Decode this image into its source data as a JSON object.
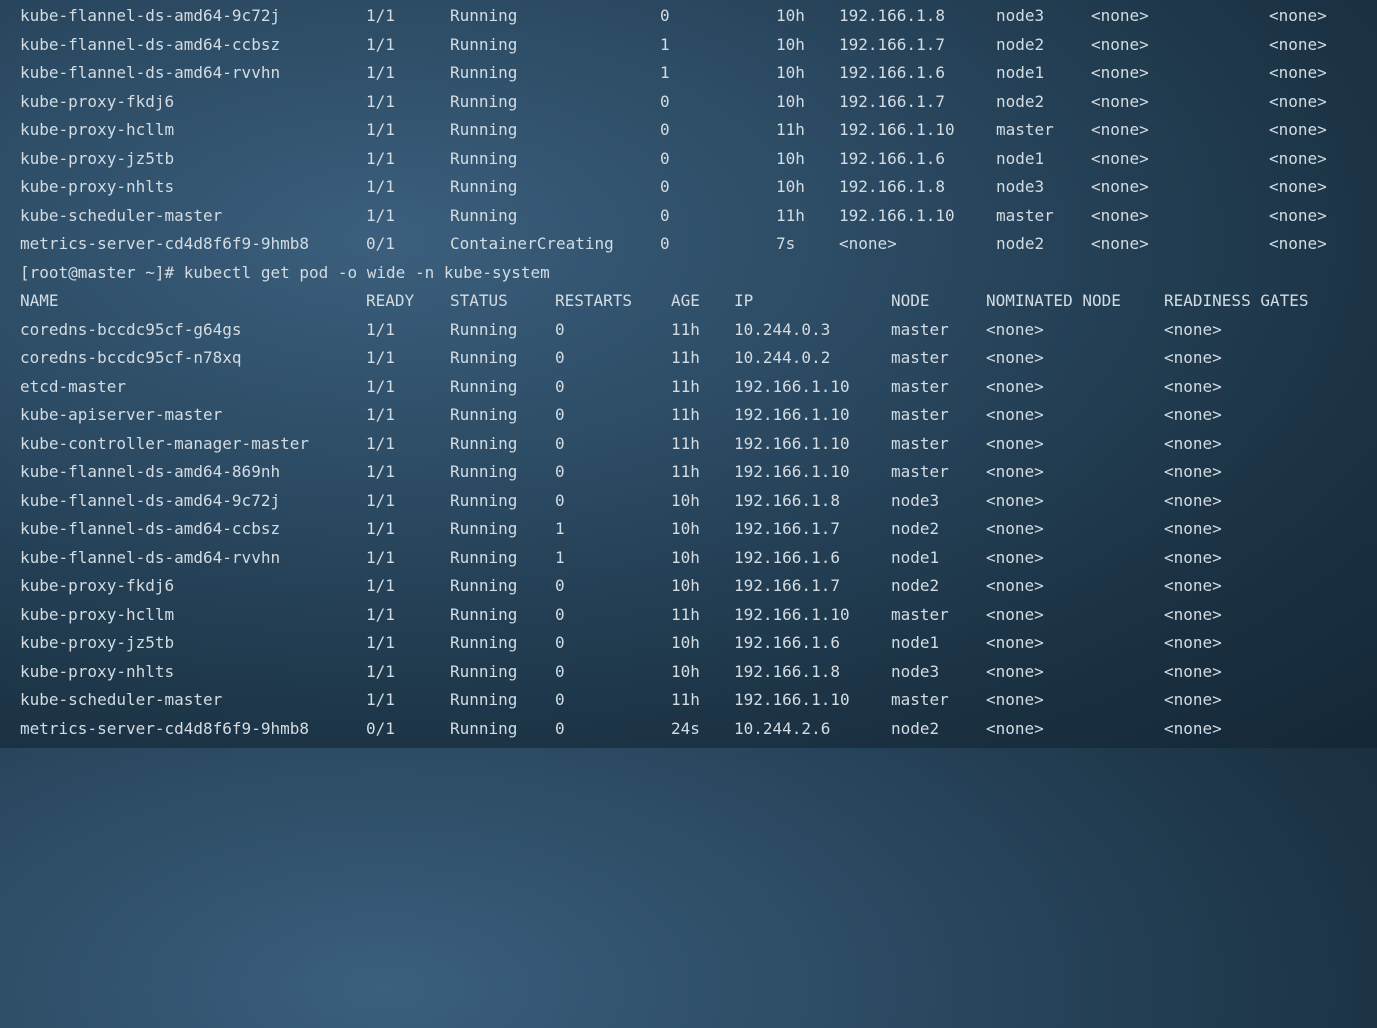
{
  "prev_rows": [
    {
      "name": "kube-flannel-ds-amd64-9c72j",
      "ready": "1/1",
      "status": "Running",
      "restarts": "0",
      "age": "10h",
      "ip": "192.166.1.8",
      "node": "node3",
      "nominated": "<none>",
      "readiness": "<none>"
    },
    {
      "name": "kube-flannel-ds-amd64-ccbsz",
      "ready": "1/1",
      "status": "Running",
      "restarts": "1",
      "age": "10h",
      "ip": "192.166.1.7",
      "node": "node2",
      "nominated": "<none>",
      "readiness": "<none>"
    },
    {
      "name": "kube-flannel-ds-amd64-rvvhn",
      "ready": "1/1",
      "status": "Running",
      "restarts": "1",
      "age": "10h",
      "ip": "192.166.1.6",
      "node": "node1",
      "nominated": "<none>",
      "readiness": "<none>"
    },
    {
      "name": "kube-proxy-fkdj6",
      "ready": "1/1",
      "status": "Running",
      "restarts": "0",
      "age": "10h",
      "ip": "192.166.1.7",
      "node": "node2",
      "nominated": "<none>",
      "readiness": "<none>"
    },
    {
      "name": "kube-proxy-hcllm",
      "ready": "1/1",
      "status": "Running",
      "restarts": "0",
      "age": "11h",
      "ip": "192.166.1.10",
      "node": "master",
      "nominated": "<none>",
      "readiness": "<none>"
    },
    {
      "name": "kube-proxy-jz5tb",
      "ready": "1/1",
      "status": "Running",
      "restarts": "0",
      "age": "10h",
      "ip": "192.166.1.6",
      "node": "node1",
      "nominated": "<none>",
      "readiness": "<none>"
    },
    {
      "name": "kube-proxy-nhlts",
      "ready": "1/1",
      "status": "Running",
      "restarts": "0",
      "age": "10h",
      "ip": "192.166.1.8",
      "node": "node3",
      "nominated": "<none>",
      "readiness": "<none>"
    },
    {
      "name": "kube-scheduler-master",
      "ready": "1/1",
      "status": "Running",
      "restarts": "0",
      "age": "11h",
      "ip": "192.166.1.10",
      "node": "master",
      "nominated": "<none>",
      "readiness": "<none>"
    },
    {
      "name": "metrics-server-cd4d8f6f9-9hmb8",
      "ready": "0/1",
      "status": "ContainerCreating",
      "restarts": "0",
      "age": "7s",
      "ip": "<none>",
      "node": "node2",
      "nominated": "<none>",
      "readiness": "<none>"
    }
  ],
  "command": "[root@master ~]# kubectl get pod -o wide -n kube-system",
  "headers": {
    "name": "NAME",
    "ready": "READY",
    "status": "STATUS",
    "restarts": "RESTARTS",
    "age": "AGE",
    "ip": "IP",
    "node": "NODE",
    "nominated": "NOMINATED NODE",
    "readiness": "READINESS GATES"
  },
  "rows": [
    {
      "name": "coredns-bccdc95cf-g64gs",
      "ready": "1/1",
      "status": "Running",
      "restarts": "0",
      "age": "11h",
      "ip": "10.244.0.3",
      "node": "master",
      "nominated": "<none>",
      "readiness": "<none>"
    },
    {
      "name": "coredns-bccdc95cf-n78xq",
      "ready": "1/1",
      "status": "Running",
      "restarts": "0",
      "age": "11h",
      "ip": "10.244.0.2",
      "node": "master",
      "nominated": "<none>",
      "readiness": "<none>"
    },
    {
      "name": "etcd-master",
      "ready": "1/1",
      "status": "Running",
      "restarts": "0",
      "age": "11h",
      "ip": "192.166.1.10",
      "node": "master",
      "nominated": "<none>",
      "readiness": "<none>"
    },
    {
      "name": "kube-apiserver-master",
      "ready": "1/1",
      "status": "Running",
      "restarts": "0",
      "age": "11h",
      "ip": "192.166.1.10",
      "node": "master",
      "nominated": "<none>",
      "readiness": "<none>"
    },
    {
      "name": "kube-controller-manager-master",
      "ready": "1/1",
      "status": "Running",
      "restarts": "0",
      "age": "11h",
      "ip": "192.166.1.10",
      "node": "master",
      "nominated": "<none>",
      "readiness": "<none>"
    },
    {
      "name": "kube-flannel-ds-amd64-869nh",
      "ready": "1/1",
      "status": "Running",
      "restarts": "0",
      "age": "11h",
      "ip": "192.166.1.10",
      "node": "master",
      "nominated": "<none>",
      "readiness": "<none>"
    },
    {
      "name": "kube-flannel-ds-amd64-9c72j",
      "ready": "1/1",
      "status": "Running",
      "restarts": "0",
      "age": "10h",
      "ip": "192.166.1.8",
      "node": "node3",
      "nominated": "<none>",
      "readiness": "<none>"
    },
    {
      "name": "kube-flannel-ds-amd64-ccbsz",
      "ready": "1/1",
      "status": "Running",
      "restarts": "1",
      "age": "10h",
      "ip": "192.166.1.7",
      "node": "node2",
      "nominated": "<none>",
      "readiness": "<none>"
    },
    {
      "name": "kube-flannel-ds-amd64-rvvhn",
      "ready": "1/1",
      "status": "Running",
      "restarts": "1",
      "age": "10h",
      "ip": "192.166.1.6",
      "node": "node1",
      "nominated": "<none>",
      "readiness": "<none>"
    },
    {
      "name": "kube-proxy-fkdj6",
      "ready": "1/1",
      "status": "Running",
      "restarts": "0",
      "age": "10h",
      "ip": "192.166.1.7",
      "node": "node2",
      "nominated": "<none>",
      "readiness": "<none>"
    },
    {
      "name": "kube-proxy-hcllm",
      "ready": "1/1",
      "status": "Running",
      "restarts": "0",
      "age": "11h",
      "ip": "192.166.1.10",
      "node": "master",
      "nominated": "<none>",
      "readiness": "<none>"
    },
    {
      "name": "kube-proxy-jz5tb",
      "ready": "1/1",
      "status": "Running",
      "restarts": "0",
      "age": "10h",
      "ip": "192.166.1.6",
      "node": "node1",
      "nominated": "<none>",
      "readiness": "<none>"
    },
    {
      "name": "kube-proxy-nhlts",
      "ready": "1/1",
      "status": "Running",
      "restarts": "0",
      "age": "10h",
      "ip": "192.166.1.8",
      "node": "node3",
      "nominated": "<none>",
      "readiness": "<none>"
    },
    {
      "name": "kube-scheduler-master",
      "ready": "1/1",
      "status": "Running",
      "restarts": "0",
      "age": "11h",
      "ip": "192.166.1.10",
      "node": "master",
      "nominated": "<none>",
      "readiness": "<none>"
    },
    {
      "name": "metrics-server-cd4d8f6f9-9hmb8",
      "ready": "0/1",
      "status": "Running",
      "restarts": "0",
      "age": "24s",
      "ip": "10.244.2.6",
      "node": "node2",
      "nominated": "<none>",
      "readiness": "<none>"
    }
  ]
}
